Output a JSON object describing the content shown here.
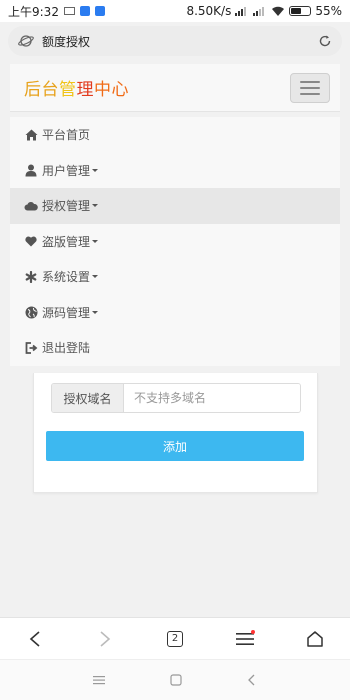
{
  "status_bar": {
    "time": "上午9:32",
    "network_speed": "8.50K/s",
    "battery": "55%",
    "battery_level": 0.55
  },
  "browser": {
    "url_text": "额度授权"
  },
  "header": {
    "brand_parts": [
      {
        "text": "后台",
        "color": "#e7a21c"
      },
      {
        "text": "管",
        "color": "#f0c419"
      },
      {
        "text": "理",
        "color": "#e23b1e"
      },
      {
        "text": "中心",
        "color": "#f06b16"
      }
    ]
  },
  "menu": {
    "items": [
      {
        "label": "平台首页",
        "icon": "home-icon",
        "dropdown": false,
        "active": false
      },
      {
        "label": "用户管理",
        "icon": "user-icon",
        "dropdown": true,
        "active": false
      },
      {
        "label": "授权管理",
        "icon": "cloud-icon",
        "dropdown": true,
        "active": true
      },
      {
        "label": "盗版管理",
        "icon": "heart-icon",
        "dropdown": true,
        "active": false
      },
      {
        "label": "系统设置",
        "icon": "asterisk-icon",
        "dropdown": true,
        "active": false
      },
      {
        "label": "源码管理",
        "icon": "globe-icon",
        "dropdown": true,
        "active": false
      },
      {
        "label": "退出登陆",
        "icon": "logout-icon",
        "dropdown": false,
        "active": false
      }
    ]
  },
  "form": {
    "domain_label": "授权域名",
    "domain_placeholder": "不支持多域名",
    "domain_value": "",
    "submit_label": "添加"
  },
  "toolbar": {
    "tab_count": "2"
  },
  "colors": {
    "accent_button": "#3db8f0",
    "active_menu_bg": "#e7e7e7"
  }
}
